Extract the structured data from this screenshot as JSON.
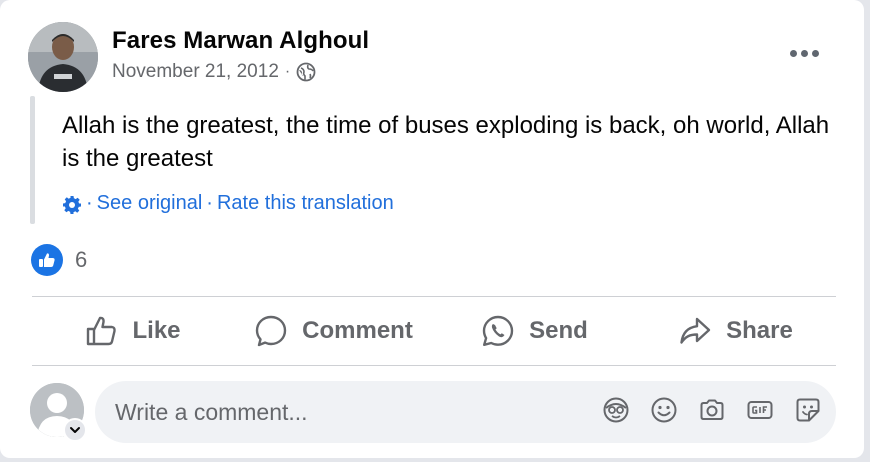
{
  "post": {
    "author": "Fares Marwan Alghoul",
    "date": "November 21, 2012",
    "separator": "·",
    "privacy_icon": "globe-icon",
    "more_icon": "more-options-icon",
    "text": "Allah is the greatest, the time of buses exploding is back, oh world, Allah is the greatest"
  },
  "translation": {
    "icon": "gear-icon",
    "see_original": "See original",
    "rate": "Rate this translation",
    "separator": "·"
  },
  "reactions": {
    "icon": "like-reaction-icon",
    "count": "6"
  },
  "actions": {
    "like": "Like",
    "comment": "Comment",
    "send": "Send",
    "share": "Share"
  },
  "comment_box": {
    "placeholder": "Write a comment...",
    "icons": [
      "avatar-sticker-icon",
      "emoji-icon",
      "camera-icon",
      "gif-icon",
      "sticker-icon"
    ]
  },
  "colors": {
    "link": "#216fdb",
    "like_blue": "#1b74e4",
    "muted_text": "#65676b"
  }
}
